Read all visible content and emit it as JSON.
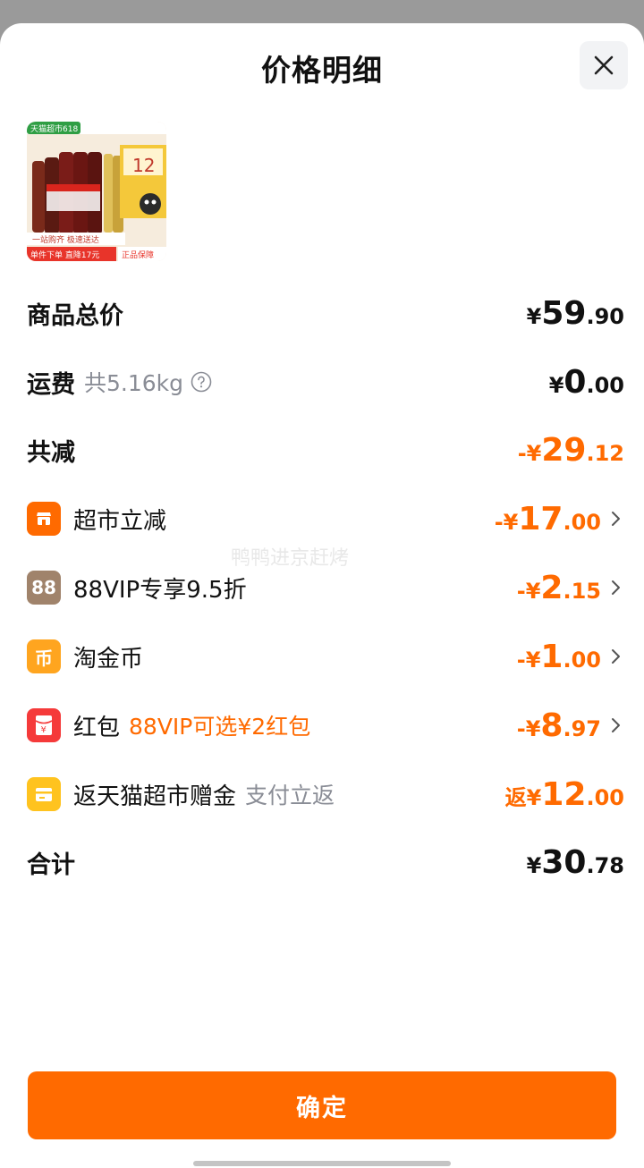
{
  "header": {
    "title": "价格明细",
    "close_icon": "close-icon"
  },
  "product": {
    "image_badge": "天猫超市618",
    "image_banner_line1": "一站购齐 极速送达",
    "image_banner_line2": "单件下单 直降17元",
    "image_banner_line3": "正品保障",
    "image_pack_label": "12"
  },
  "rows": {
    "goods_total": {
      "label": "商品总价",
      "currency": "¥",
      "int": "59",
      "dec": ".90"
    },
    "shipping": {
      "label": "运费",
      "sub": "共5.16kg",
      "help_icon": "help-circle-icon",
      "currency": "¥",
      "int": "0",
      "dec": ".00"
    },
    "total_discount": {
      "label": "共减",
      "currency": "-¥",
      "int": "29",
      "dec": ".12"
    },
    "supermarket_discount": {
      "icon": "shop-icon",
      "icon_color": "#ff6a00",
      "label": "超市立减",
      "currency": "-¥",
      "int": "17",
      "dec": ".00"
    },
    "vip_discount": {
      "icon": "vip88-icon",
      "icon_text": "88",
      "icon_color": "#a0836b",
      "label": "88VIP专享9.5折",
      "currency": "-¥",
      "int": "2",
      "dec": ".15"
    },
    "gold_coin": {
      "icon": "coin-icon",
      "icon_text": "币",
      "icon_color": "#ffa51f",
      "label": "淘金币",
      "currency": "-¥",
      "int": "1",
      "dec": ".00"
    },
    "red_packet": {
      "icon": "red-packet-icon",
      "icon_text": "¥",
      "icon_color": "#f53a3a",
      "label": "红包",
      "sub": "88VIP可选¥2红包",
      "currency": "-¥",
      "int": "8",
      "dec": ".97"
    },
    "cashback": {
      "icon": "gift-card-icon",
      "icon_color": "#ffc31f",
      "label": "返天猫超市赠金",
      "sub": "支付立返",
      "currency": "返¥",
      "int": "12",
      "dec": ".00"
    },
    "grand_total": {
      "label": "合计",
      "currency": "¥",
      "int": "30",
      "dec": ".78"
    }
  },
  "watermark": "鸭鸭进京赶烤",
  "footer": {
    "confirm_label": "确定"
  },
  "colors": {
    "accent": "#ff6a00",
    "text": "#111111",
    "muted": "#8a8d96"
  }
}
